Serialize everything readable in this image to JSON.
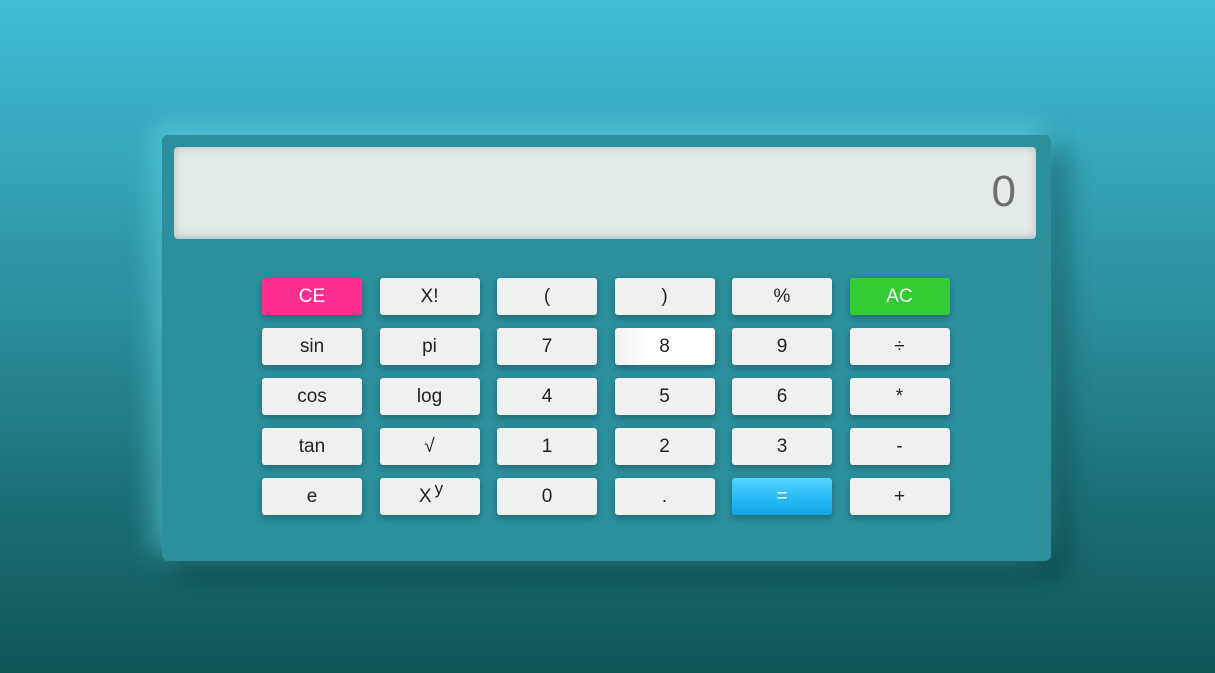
{
  "display": {
    "value": "0"
  },
  "keys": [
    {
      "label": "CE",
      "name": "clear-entry-button",
      "style": "clear-entry"
    },
    {
      "label": "X!",
      "name": "factorial-button"
    },
    {
      "label": "(",
      "name": "open-paren-button"
    },
    {
      "label": ")",
      "name": "close-paren-button"
    },
    {
      "label": "%",
      "name": "percent-button"
    },
    {
      "label": "AC",
      "name": "all-clear-button",
      "style": "all-clear"
    },
    {
      "label": "sin",
      "name": "sin-button"
    },
    {
      "label": "pi",
      "name": "pi-button"
    },
    {
      "label": "7",
      "name": "digit-7-button"
    },
    {
      "label": "8",
      "name": "digit-8-button",
      "style": "active"
    },
    {
      "label": "9",
      "name": "digit-9-button"
    },
    {
      "label": "÷",
      "name": "divide-button"
    },
    {
      "label": "cos",
      "name": "cos-button"
    },
    {
      "label": "log",
      "name": "log-button"
    },
    {
      "label": "4",
      "name": "digit-4-button"
    },
    {
      "label": "5",
      "name": "digit-5-button"
    },
    {
      "label": "6",
      "name": "digit-6-button"
    },
    {
      "label": "*",
      "name": "multiply-button"
    },
    {
      "label": "tan",
      "name": "tan-button"
    },
    {
      "label": "√",
      "name": "sqrt-button"
    },
    {
      "label": "1",
      "name": "digit-1-button"
    },
    {
      "label": "2",
      "name": "digit-2-button"
    },
    {
      "label": "3",
      "name": "digit-3-button"
    },
    {
      "label": "-",
      "name": "subtract-button"
    },
    {
      "label": "e",
      "name": "euler-button"
    },
    {
      "label": "X",
      "sup": "y",
      "name": "power-button"
    },
    {
      "label": "0",
      "name": "digit-0-button"
    },
    {
      "label": ".",
      "name": "decimal-button"
    },
    {
      "label": "=",
      "name": "equals-button",
      "style": "equals"
    },
    {
      "label": "+",
      "name": "add-button"
    }
  ],
  "colors": {
    "clear_entry": "#ff2e93",
    "all_clear": "#33cc33",
    "equals": "#22b8f5",
    "panel": "#2b8f9c",
    "display": "#e3ebe8"
  }
}
